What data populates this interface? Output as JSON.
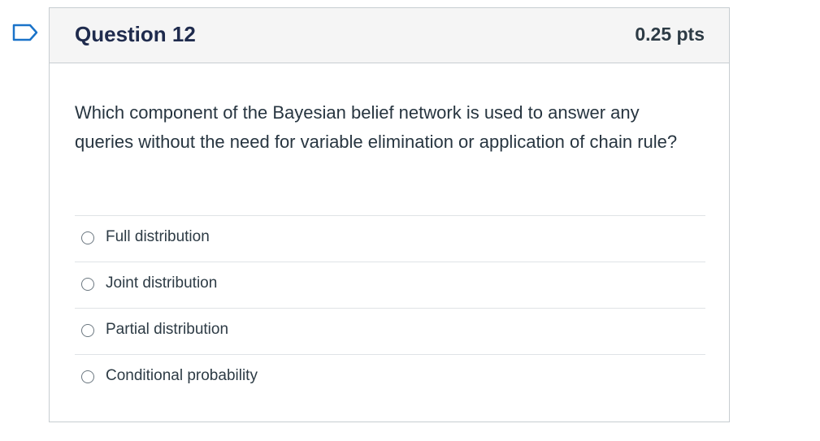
{
  "question": {
    "title": "Question 12",
    "points": "0.25 pts",
    "text": "Which component of the Bayesian belief network is used to answer any queries without the need for variable elimination or application of chain rule?",
    "flag_icon": "flag-outline-icon"
  },
  "answers": [
    {
      "label": "Full distribution",
      "selected": false
    },
    {
      "label": "Joint distribution",
      "selected": false
    },
    {
      "label": "Partial distribution",
      "selected": false
    },
    {
      "label": "Conditional probability",
      "selected": false
    }
  ],
  "colors": {
    "border": "#c7cdd1",
    "header_bg": "#f5f5f5",
    "flag": "#1a73c9",
    "text": "#2d3b45"
  }
}
